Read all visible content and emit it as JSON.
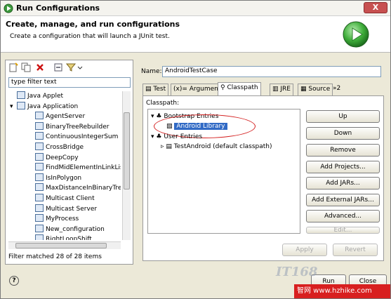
{
  "window": {
    "title": "Run Configurations",
    "close_label": "X"
  },
  "header": {
    "title": "Create, manage, and run configurations",
    "subtitle": "Create a configuration that will launch a JUnit test."
  },
  "left": {
    "filter_text": "type filter text",
    "status": "Filter matched 28 of 28 items",
    "tree": [
      {
        "label": "Java Applet",
        "level": 1,
        "expander": ""
      },
      {
        "label": "Java Application",
        "level": 1,
        "expander": "▾"
      },
      {
        "label": "AgentServer",
        "level": 2
      },
      {
        "label": "BinaryTreeRebuilder",
        "level": 2
      },
      {
        "label": "ContinuousIntegerSum",
        "level": 2
      },
      {
        "label": "CrossBridge",
        "level": 2
      },
      {
        "label": "DeepCopy",
        "level": 2
      },
      {
        "label": "FindMidElementInLinkList",
        "level": 2
      },
      {
        "label": "IsInPolygon",
        "level": 2
      },
      {
        "label": "MaxDistanceInBinaryTree",
        "level": 2
      },
      {
        "label": "Multicast Client",
        "level": 2
      },
      {
        "label": "Multicast Server",
        "level": 2
      },
      {
        "label": "MyProcess",
        "level": 2
      },
      {
        "label": "New_configuration",
        "level": 2
      },
      {
        "label": "RightLoopShift",
        "level": 2
      }
    ]
  },
  "right": {
    "name_label": "Name:",
    "name_value": "AndroidTestCase",
    "tabs": [
      {
        "label": "Test"
      },
      {
        "label": "Arguments"
      },
      {
        "label": "Classpath"
      },
      {
        "label": "JRE"
      },
      {
        "label": "Source"
      },
      {
        "label": "»2"
      }
    ],
    "classpath_label": "Classpath:",
    "classpath_tree": {
      "bootstrap": "Bootstrap Entries",
      "android_library": "Android Library",
      "user": "User Entries",
      "test_android": "TestAndroid (default classpath)"
    },
    "buttons": {
      "up": "Up",
      "down": "Down",
      "remove": "Remove",
      "add_projects": "Add Projects...",
      "add_jars": "Add JARs...",
      "add_external_jars": "Add External JARs...",
      "advanced": "Advanced...",
      "edit": "Edit..."
    },
    "apply": "Apply",
    "revert": "Revert"
  },
  "bottom": {
    "help": "?",
    "run": "Run",
    "close": "Close"
  },
  "watermark": {
    "brand": "IT168",
    "site": "智网 www.hzhike.com"
  }
}
